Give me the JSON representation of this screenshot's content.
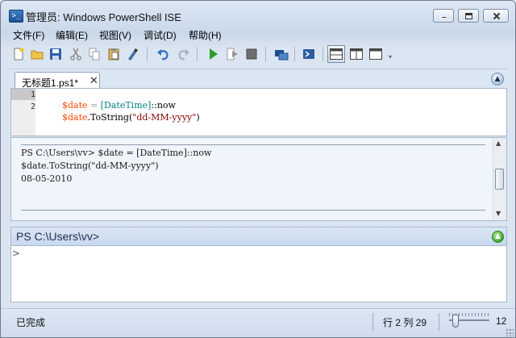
{
  "window": {
    "title": "管理员: Windows PowerShell ISE",
    "app_icon_glyph": ">_"
  },
  "menu": [
    {
      "label": "文件(F)"
    },
    {
      "label": "编辑(E)"
    },
    {
      "label": "视图(V)"
    },
    {
      "label": "调试(D)"
    },
    {
      "label": "帮助(H)"
    }
  ],
  "toolbar": {
    "icons": [
      "new-file-icon",
      "open-folder-icon",
      "save-icon",
      "cut-icon",
      "copy-icon",
      "paste-icon",
      "clear-icon",
      "undo-icon",
      "redo-icon",
      "run-icon",
      "run-selection-icon",
      "stop-icon",
      "remote-powershell-icon",
      "powershell-console-icon",
      "layout-top-icon",
      "layout-right-icon",
      "layout-max-icon"
    ]
  },
  "tab": {
    "label": "无标题1.ps1*",
    "close_glyph": "✕"
  },
  "script": {
    "line_numbers": [
      "1",
      "2"
    ],
    "lines": [
      {
        "var": "$date",
        "op": " = ",
        "type": "[DateTime]",
        "rest": "::now"
      },
      {
        "var": "$date",
        "method": ".ToString(",
        "str": "\"dd-MM-yyyy\"",
        "end": ")"
      }
    ]
  },
  "output": {
    "lines": [
      "PS C:\\Users\\vv> $date = [DateTime]::now",
      "$date.ToString(\"dd-MM-yyyy\")",
      "08-05-2010"
    ]
  },
  "command_pane": {
    "prompt": "PS C:\\Users\\vv>",
    "input_caret": ">",
    "input_value": ""
  },
  "status": {
    "text": "已完成",
    "position": "行 2  列 29",
    "zoom": "12"
  },
  "colors": {
    "variable": "#ff4500",
    "type": "#008080",
    "string": "#8b0000",
    "operator": "#a9a9a9"
  }
}
